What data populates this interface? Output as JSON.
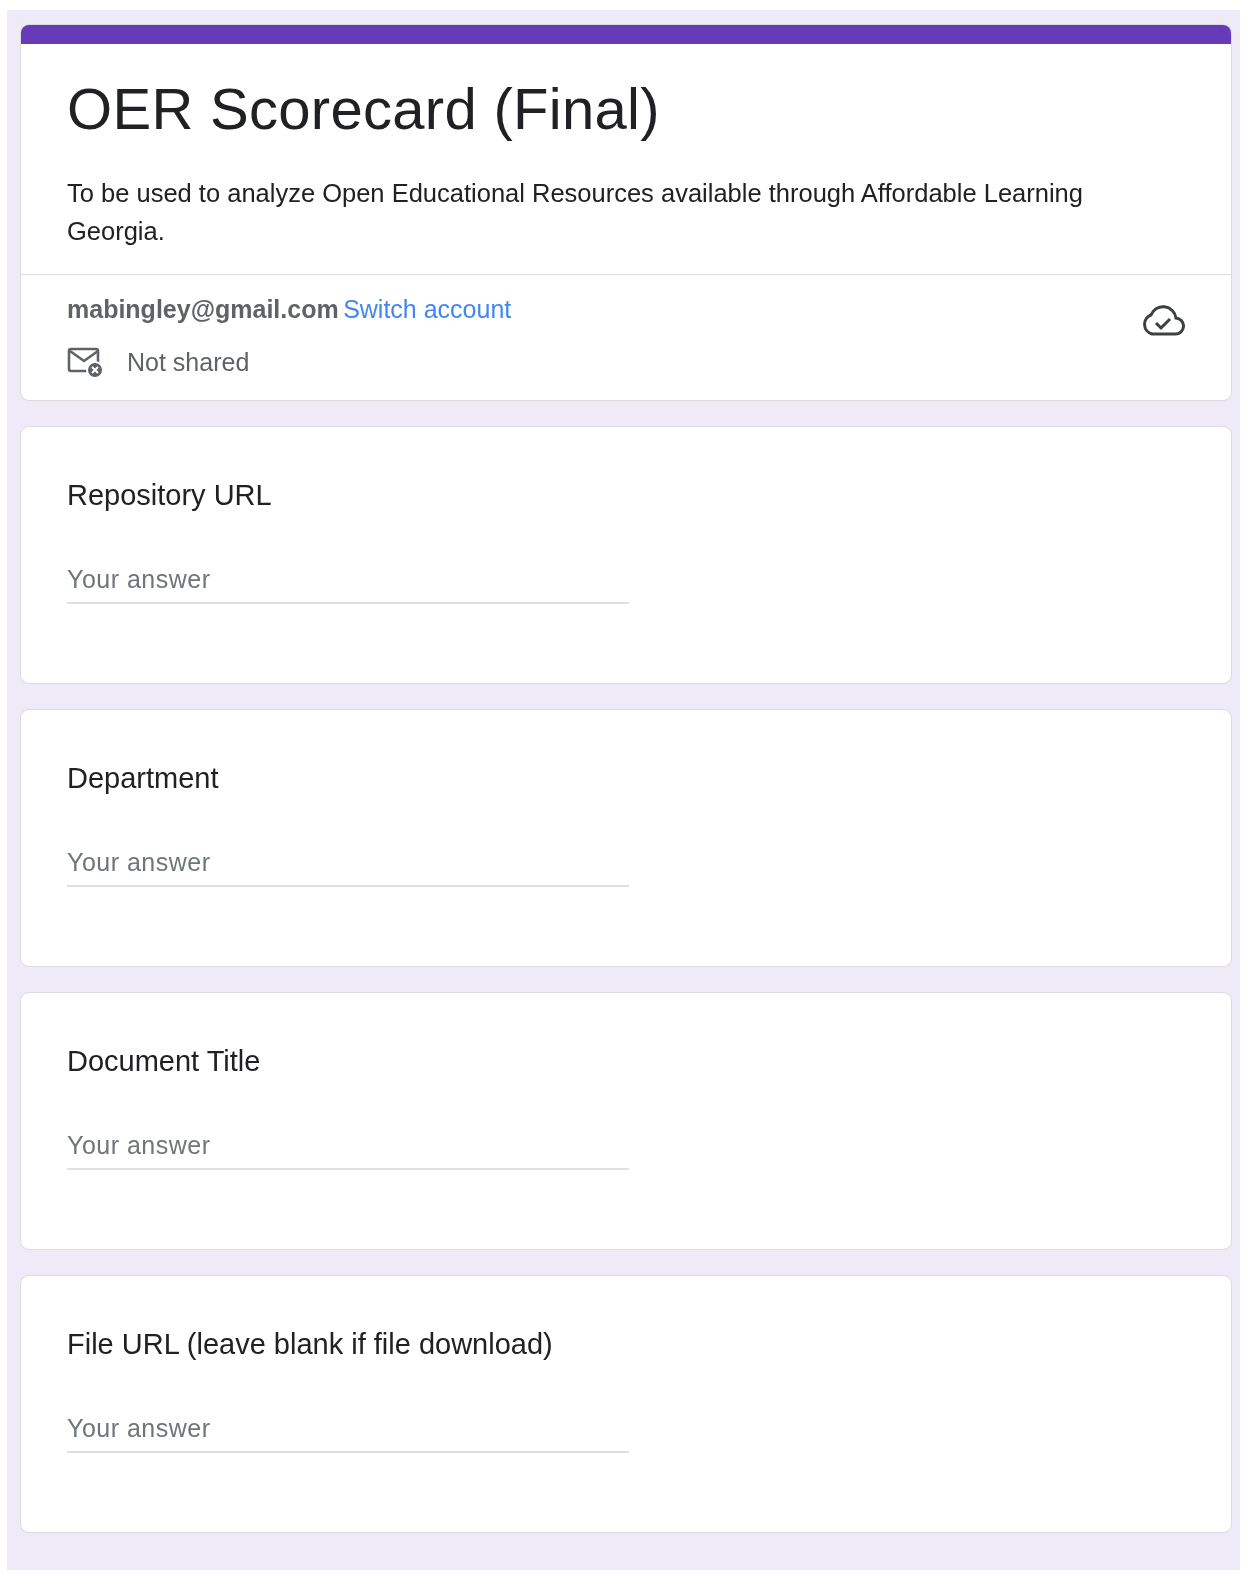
{
  "header": {
    "title": "OER Scorecard (Final)",
    "description": "To be used to analyze Open Educational Resources available through Affordable Learning Georgia.",
    "account": {
      "email": "mabingley@gmail.com",
      "switch_link": "Switch account",
      "sharing": "Not shared"
    }
  },
  "questions": [
    {
      "label": "Repository URL",
      "placeholder": "Your answer"
    },
    {
      "label": "Department",
      "placeholder": "Your answer"
    },
    {
      "label": "Document Title",
      "placeholder": "Your answer"
    },
    {
      "label": "File URL (leave blank if file download)",
      "placeholder": "Your answer"
    }
  ]
}
